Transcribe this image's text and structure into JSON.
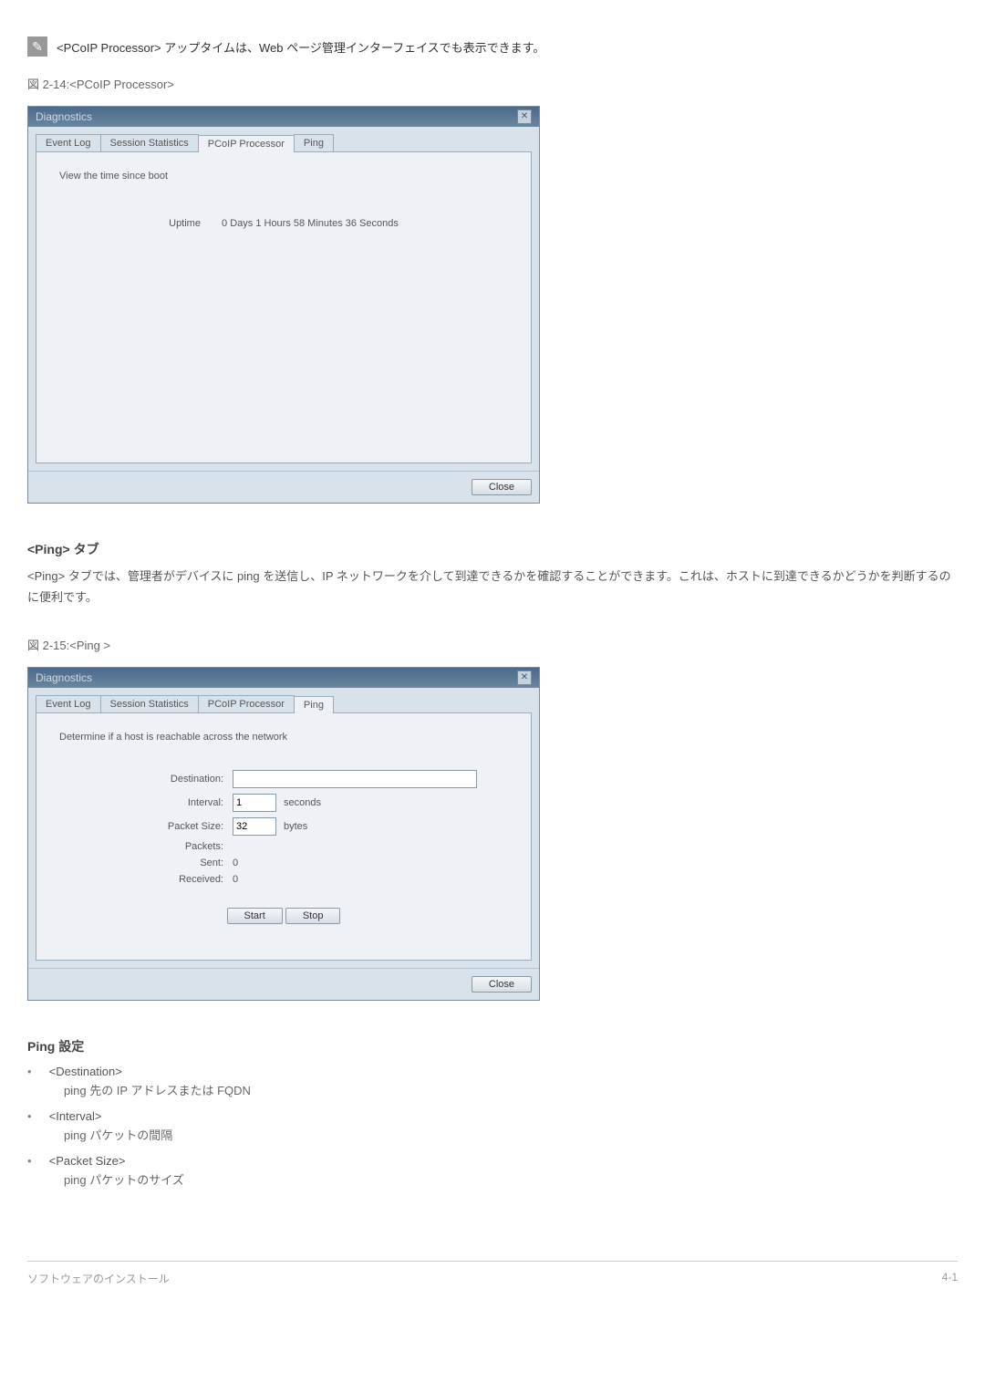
{
  "note": {
    "text": "<PCoIP Processor> アップタイムは、Web ページ管理インターフェイスでも表示できます。"
  },
  "figure1": {
    "caption": "図 2-14:<PCoIP Processor>",
    "dialog_title": "Diagnostics",
    "tabs": {
      "event_log": "Event Log",
      "session_stats": "Session Statistics",
      "pcoip": "PCoIP Processor",
      "ping": "Ping"
    },
    "panel_heading": "View the time since boot",
    "uptime_label": "Uptime",
    "uptime_value": "0 Days 1 Hours 58 Minutes 36 Seconds",
    "close_label": "Close"
  },
  "ping_section": {
    "title": "<Ping> タブ",
    "body": "<Ping> タブでは、管理者がデバイスに ping を送信し、IP ネットワークを介して到達できるかを確認することができます。これは、ホストに到達できるかどうかを判断するのに便利です。"
  },
  "figure2": {
    "caption": "図 2-15:<Ping >",
    "dialog_title": "Diagnostics",
    "tabs": {
      "event_log": "Event Log",
      "session_stats": "Session Statistics",
      "pcoip": "PCoIP Processor",
      "ping": "Ping"
    },
    "panel_heading": "Determine if a host is reachable across the network",
    "labels": {
      "destination": "Destination:",
      "interval": "Interval:",
      "packet_size": "Packet Size:",
      "packets": "Packets:",
      "sent": "Sent:",
      "received": "Received:"
    },
    "values": {
      "destination": "",
      "interval": "1",
      "interval_unit": "seconds",
      "packet_size": "32",
      "packet_size_unit": "bytes",
      "sent": "0",
      "received": "0"
    },
    "buttons": {
      "start": "Start",
      "stop": "Stop",
      "close": "Close"
    }
  },
  "ping_settings": {
    "title": "Ping 設定",
    "items": [
      {
        "title": "<Destination>",
        "desc": "ping 先の IP アドレスまたは FQDN"
      },
      {
        "title": "<Interval>",
        "desc": "ping パケットの間隔"
      },
      {
        "title": "<Packet Size>",
        "desc": "ping パケットのサイズ"
      }
    ]
  },
  "footer": {
    "left": "ソフトウェアのインストール",
    "right": "4-1"
  }
}
